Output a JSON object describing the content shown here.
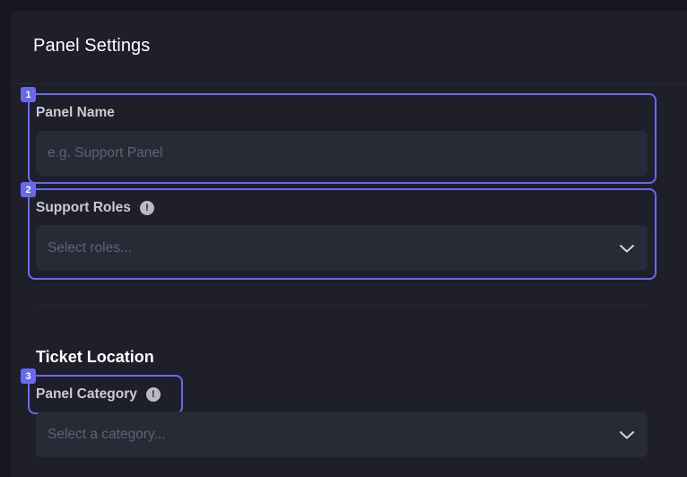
{
  "panel": {
    "title": "Panel Settings"
  },
  "fields": {
    "panel_name": {
      "number": "1",
      "label": "Panel Name",
      "placeholder": "e.g. Support Panel"
    },
    "support_roles": {
      "number": "2",
      "label": "Support Roles",
      "info": "!",
      "placeholder": "Select roles..."
    },
    "ticket_location": {
      "heading": "Ticket Location"
    },
    "panel_category": {
      "number": "3",
      "label": "Panel Category",
      "info": "!",
      "placeholder": "Select a category..."
    }
  },
  "colors": {
    "accent": "#6b68f0",
    "background": "#17181f",
    "panel": "#1e1f29",
    "input": "#282a36"
  },
  "icons": [
    "info-icon",
    "chevron-down-icon"
  ]
}
